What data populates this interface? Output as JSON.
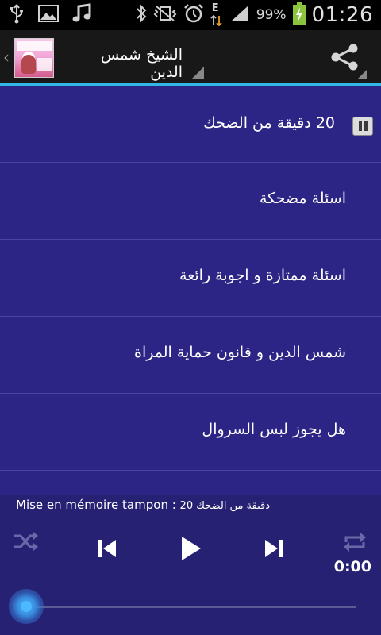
{
  "status_bar": {
    "battery_percent": "99%",
    "clock": "01:26",
    "network_type": "E",
    "icons": [
      "usb-icon",
      "image-icon",
      "music-note-icon",
      "bluetooth-icon",
      "no-vibrate-icon",
      "alarm-icon",
      "data-arrows-icon",
      "signal-icon",
      "battery-charging-icon"
    ]
  },
  "action_bar": {
    "title": "الشيخ شمس الدين",
    "accent_color": "#33b5e5"
  },
  "playlist": {
    "items": [
      {
        "label": "20 دقيقة من الضحك",
        "state": "playing"
      },
      {
        "label": "اسئلة مضحكة"
      },
      {
        "label": "اسئلة ممتازة و اجوبة رائعة"
      },
      {
        "label": "شمس الدين و قانون حماية المراة"
      },
      {
        "label": "هل يجوز لبس السروال"
      }
    ],
    "background_color": "#2c2585"
  },
  "player": {
    "buffer_prefix": "Mise en mémoire tampon : ",
    "buffer_title": "20 دقيقة من الضحك",
    "elapsed": "0:00",
    "progress": 0
  }
}
